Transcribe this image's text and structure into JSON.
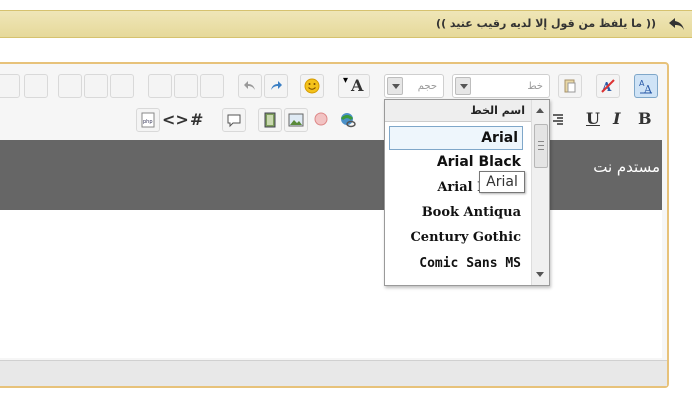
{
  "quote": {
    "text": "(( ما يلفظ من قول إلا لديه رقيب عتيد ))"
  },
  "toolbar": {
    "font_label": "خط",
    "size_label": "حجم",
    "bold": "B",
    "italic": "I",
    "underline": "U",
    "hash": "#",
    "code": "<>",
    "font_color": "A"
  },
  "dropdown": {
    "header": "اسم الخط",
    "items": [
      "Arial",
      "Arial Black",
      "Arial N",
      "Book Antiqua",
      "Century Gothic",
      "Comic Sans MS"
    ],
    "selected": "Arial"
  },
  "tooltip": {
    "text": "Arial"
  },
  "preview": {
    "text": "مستدم نت"
  }
}
